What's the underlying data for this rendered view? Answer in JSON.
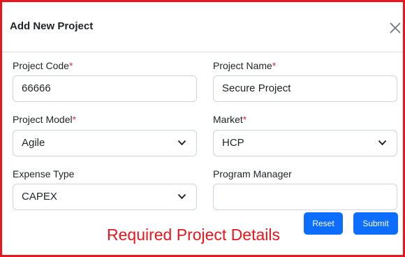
{
  "dialog": {
    "title": "Add New Project",
    "close_icon": "close-icon"
  },
  "fields": {
    "project_code": {
      "label": "Project Code",
      "required_mark": "*",
      "value": "66666"
    },
    "project_name": {
      "label": "Project Name",
      "required_mark": "*",
      "value": "Secure Project"
    },
    "project_model": {
      "label": "Project Model",
      "required_mark": "*",
      "value": "Agile"
    },
    "market": {
      "label": "Market",
      "required_mark": "*",
      "value": "HCP"
    },
    "expense_type": {
      "label": "Expense Type",
      "value": "CAPEX"
    },
    "program_manager": {
      "label": "Program Manager",
      "value": ""
    }
  },
  "buttons": {
    "reset": "Reset",
    "submit": "Submit"
  },
  "annotation": "Required Project Details",
  "colors": {
    "accent": "#0d6efd",
    "required": "#dc3545",
    "annotation": "#e8161d"
  }
}
